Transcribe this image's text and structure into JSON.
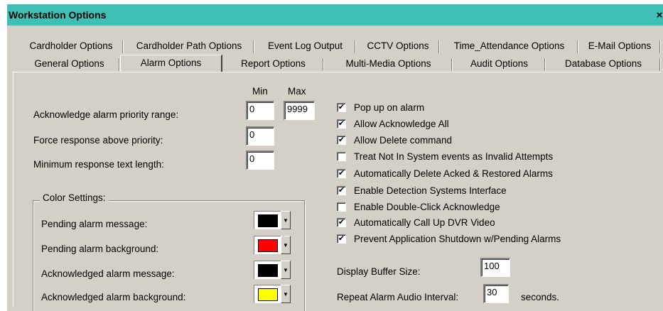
{
  "window": {
    "title": "Workstation Options",
    "close_glyph": "×"
  },
  "tabs_row1": [
    {
      "label": "Cardholder Options"
    },
    {
      "label": "Cardholder Path Options"
    },
    {
      "label": "Event Log Output"
    },
    {
      "label": "CCTV Options"
    },
    {
      "label": "Time_Attendance Options"
    },
    {
      "label": "E-Mail Options"
    }
  ],
  "tabs_row2": [
    {
      "label": "General Options"
    },
    {
      "label": "Alarm Options",
      "active": true
    },
    {
      "label": "Report Options"
    },
    {
      "label": "Multi-Media Options"
    },
    {
      "label": "Audit Options"
    },
    {
      "label": "Database Options"
    }
  ],
  "priority": {
    "min_header": "Min",
    "max_header": "Max",
    "ack_label": "Acknowledge alarm priority range:",
    "ack_min": "0",
    "ack_max": "9999",
    "force_label": "Force response above priority:",
    "force_value": "0",
    "min_resp_label": "Minimum response text length:",
    "min_resp_value": "0"
  },
  "color_settings": {
    "title": "Color Settings:",
    "items": [
      {
        "label": "Pending alarm message:",
        "color": "#000000"
      },
      {
        "label": "Pending alarm background:",
        "color": "#ff0000"
      },
      {
        "label": "Acknowledged alarm message:",
        "color": "#000000"
      },
      {
        "label": "Acknowledged alarm background:",
        "color": "#ffff00"
      }
    ]
  },
  "checkboxes": [
    {
      "label": "Pop up on alarm",
      "checked": true
    },
    {
      "label": "Allow Acknowledge All",
      "checked": true
    },
    {
      "label": "Allow Delete command",
      "checked": true
    },
    {
      "label": "Treat Not In System events as Invalid Attempts",
      "checked": false
    },
    {
      "label": "Automatically Delete Acked & Restored Alarms",
      "checked": true
    },
    {
      "label": "Enable Detection Systems Interface",
      "checked": true
    },
    {
      "label": "Enable Double-Click Acknowledge",
      "checked": false
    },
    {
      "label": "Automatically Call Up DVR Video",
      "checked": true
    },
    {
      "label": "Prevent Application Shutdown w/Pending Alarms",
      "checked": true
    }
  ],
  "buffer": {
    "label": "Display Buffer Size:",
    "value": "100",
    "repeat_label": "Repeat Alarm Audio Interval:",
    "repeat_value": "30",
    "unit": "seconds."
  }
}
